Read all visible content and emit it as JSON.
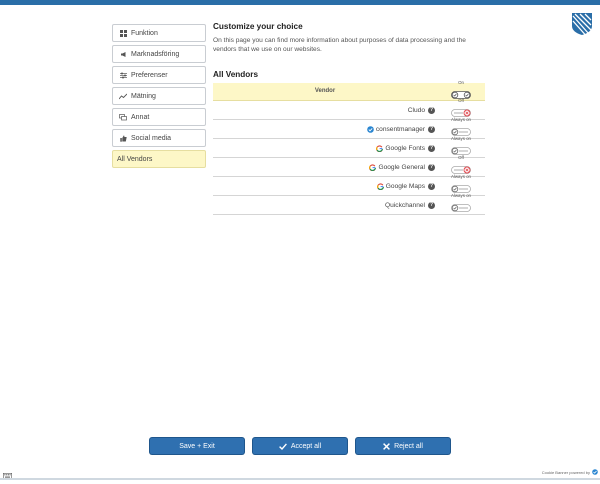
{
  "sidebar": {
    "items": [
      {
        "label": "Funktion",
        "icon": "grid-icon"
      },
      {
        "label": "Marknadsföring",
        "icon": "megaphone-icon"
      },
      {
        "label": "Preferenser",
        "icon": "sliders-icon"
      },
      {
        "label": "Mätning",
        "icon": "chart-line-icon"
      },
      {
        "label": "Annat",
        "icon": "chat-icon"
      },
      {
        "label": "Social media",
        "icon": "thumbs-up-icon"
      },
      {
        "label": "All Vendors",
        "icon": ""
      }
    ]
  },
  "content": {
    "title": "Customize your choice",
    "description": "On this page you can find more information about purposes of data processing and the vendors that we use on our websites."
  },
  "vendors": {
    "title": "All Vendors",
    "header_label": "Vendor",
    "header_state": "On",
    "rows": [
      {
        "name": "Cludo",
        "state_label": "Off",
        "state": "off"
      },
      {
        "name": "consentmanager",
        "state_label": "Always on",
        "state": "always"
      },
      {
        "name": "Google Fonts",
        "state_label": "Always on",
        "state": "always"
      },
      {
        "name": "Google General",
        "state_label": "Off",
        "state": "off"
      },
      {
        "name": "Google Maps",
        "state_label": "Always on",
        "state": "always"
      },
      {
        "name": "Quickchannel",
        "state_label": "Always on",
        "state": "always"
      }
    ],
    "help_symbol": "?"
  },
  "buttons": {
    "save": "Save + Exit",
    "accept": "Accept all",
    "reject": "Reject all"
  },
  "footer": {
    "powered_by": "Cookie Banner powered by"
  },
  "colors": {
    "accent": "#2f70b0",
    "topbar": "#2a6ea8",
    "highlight": "#fdf7c7",
    "toggle_off": "#e0464d"
  }
}
